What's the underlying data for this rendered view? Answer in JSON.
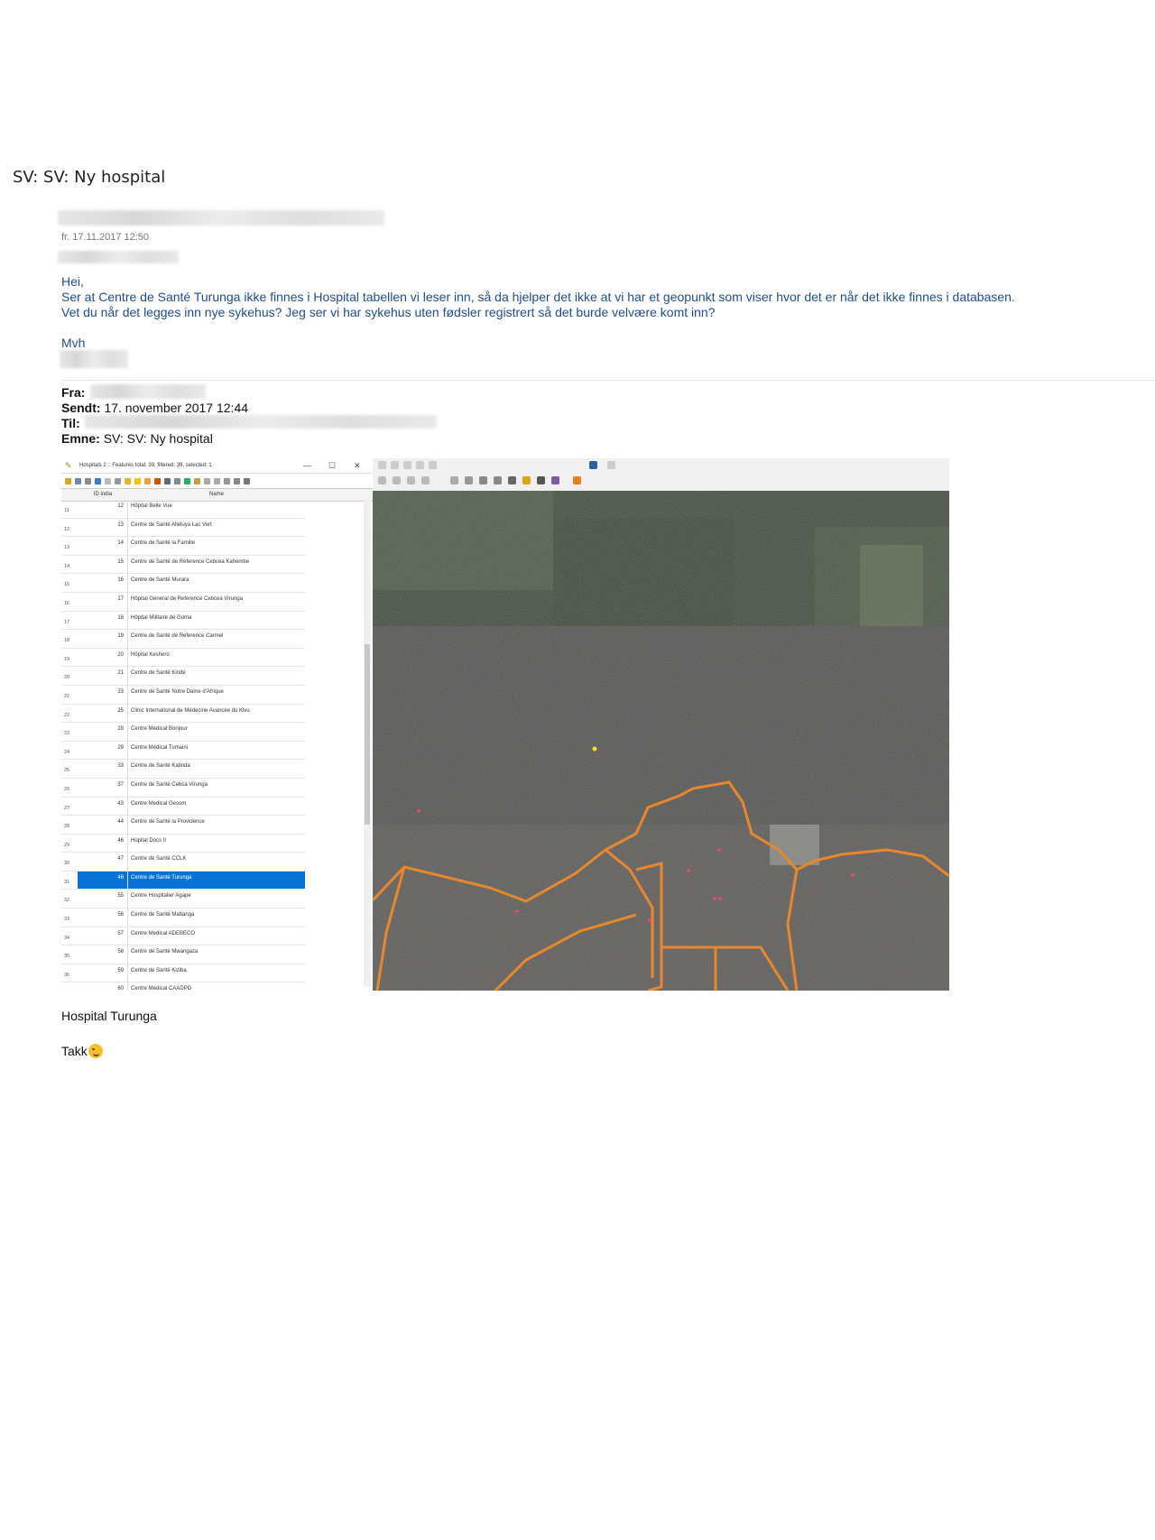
{
  "email": {
    "subject": "SV: SV: Ny hospital",
    "date": "fr. 17.11.2017 12:50",
    "greeting": "Hei,",
    "line1": "Ser at Centre de Santé Turunga ikke finnes i Hospital tabellen vi leser inn, så da hjelper det ikke at vi har et geopunkt som viser hvor det er når det ikke finnes i databasen.",
    "line2": "Vet du når det legges inn nye sykehus? Jeg ser vi har sykehus uten fødsler registrert så det burde velvære komt inn?",
    "signoff": "Mvh",
    "quoted": {
      "from_label": "Fra:",
      "sent_label": "Sendt:",
      "sent_value": "17. november 2017 12:44",
      "to_label": "Til:",
      "subject_label": "Emne:",
      "subject_value": "SV: SV: Ny hospital"
    },
    "caption": "Hospital Turunga",
    "thanks": "Takk"
  },
  "screenshot": {
    "table_title": "Hospitals 2 :: Features total: 39, filtered: 39, selected: 1",
    "window_controls": {
      "minimize": "—",
      "maximize": "☐",
      "close": "✕"
    },
    "col_id": "ID india",
    "col_name": "Name",
    "rows": [
      {
        "rn": "11",
        "id": "12",
        "name": "Hôpital Belle Vue"
      },
      {
        "rn": "12",
        "id": "13",
        "name": "Centre de Santé Alleluya Lac Vert"
      },
      {
        "rn": "13",
        "id": "14",
        "name": "Centre de Santé la Famille"
      },
      {
        "rn": "14",
        "id": "15",
        "name": "Centre de Santé de Reference Cebcea Kahembe"
      },
      {
        "rn": "15",
        "id": "16",
        "name": "Centre de Santé Murara"
      },
      {
        "rn": "16",
        "id": "17",
        "name": "Hôpital General de Reference Cebcea Virunga"
      },
      {
        "rn": "17",
        "id": "18",
        "name": "Hôpital Militaire de Goma"
      },
      {
        "rn": "18",
        "id": "19",
        "name": "Centre de Santé de Reference Carmel"
      },
      {
        "rn": "19",
        "id": "20",
        "name": "Hôpital Keshero"
      },
      {
        "rn": "20",
        "id": "21",
        "name": "Centre de Santé Kinde"
      },
      {
        "rn": "21",
        "id": "23",
        "name": "Centre de Santé Notre Dame d'Afrique"
      },
      {
        "rn": "22",
        "id": "25",
        "name": "Clinic International de Médecine Avancée du Kivu"
      },
      {
        "rn": "23",
        "id": "28",
        "name": "Centre Médical Bonjour"
      },
      {
        "rn": "24",
        "id": "29",
        "name": "Centre Médical Tumaini"
      },
      {
        "rn": "25",
        "id": "33",
        "name": "Centre de Santé Katinda"
      },
      {
        "rn": "26",
        "id": "37",
        "name": "Centre de Santé Cebca Virunga"
      },
      {
        "rn": "27",
        "id": "43",
        "name": "Centre Medical Gesom"
      },
      {
        "rn": "28",
        "id": "44",
        "name": "Centre de Santé la Providence"
      },
      {
        "rn": "29",
        "id": "46",
        "name": "Hopital Docs II"
      },
      {
        "rn": "30",
        "id": "47",
        "name": "Centre de Santé CCLK"
      },
      {
        "rn": "31",
        "id": "48",
        "name": "Centre de Santé Turunga",
        "selected": true
      },
      {
        "rn": "32",
        "id": "55",
        "name": "Centre Hospitalier Agape"
      },
      {
        "rn": "33",
        "id": "56",
        "name": "Centre de Santé Mabanga"
      },
      {
        "rn": "34",
        "id": "57",
        "name": "Centre Medical ADEBECO"
      },
      {
        "rn": "35",
        "id": "58",
        "name": "Centre de Santé Mwangaza"
      },
      {
        "rn": "36",
        "id": "59",
        "name": "Centre de Santé Kiziba"
      },
      {
        "rn": "37",
        "id": "60",
        "name": "Centre Médical CAADPD"
      }
    ]
  },
  "colors": {
    "link_blue": "#1f4e8c",
    "selection": "#0a74d6",
    "boundary": "#e8882b"
  }
}
